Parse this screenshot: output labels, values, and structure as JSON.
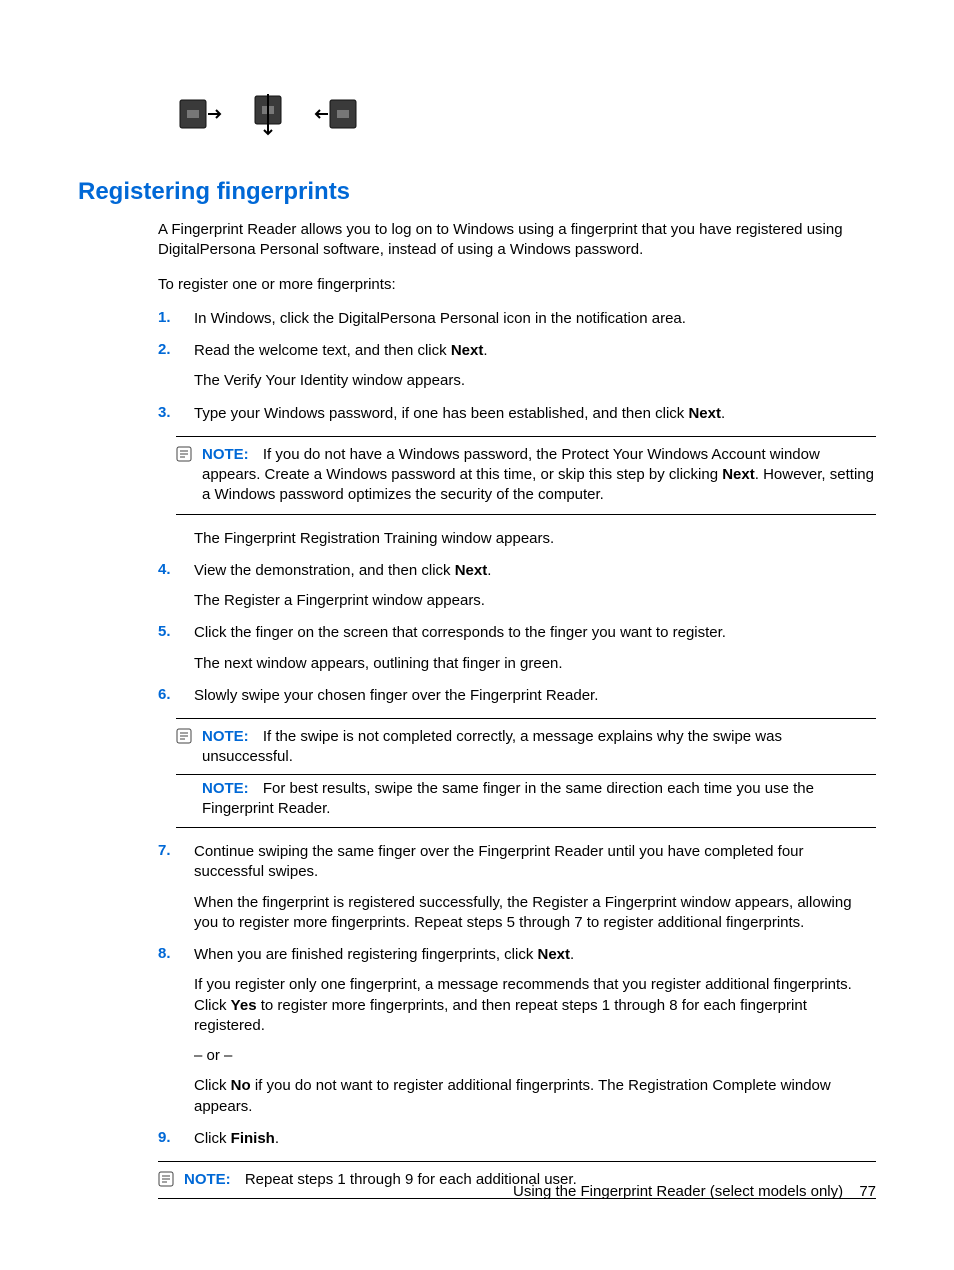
{
  "heading": "Registering fingerprints",
  "intro1": "A Fingerprint Reader allows you to log on to Windows using a fingerprint that you have registered using DigitalPersona Personal software, instead of using a Windows password.",
  "intro2": "To register one or more fingerprints:",
  "steps": {
    "s1": {
      "num": "1.",
      "text": "In Windows, click the DigitalPersona Personal icon in the notification area."
    },
    "s2": {
      "num": "2.",
      "text_a": "Read the welcome text, and then click ",
      "text_bold": "Next",
      "text_b": ".",
      "sub": "The Verify Your Identity window appears."
    },
    "s3": {
      "num": "3.",
      "text_a": "Type your Windows password, if one has been established, and then click ",
      "text_bold": "Next",
      "text_b": "."
    },
    "note1": {
      "label": "NOTE:",
      "text_a": "If you do not have a Windows password, the Protect Your Windows Account window appears. Create a Windows password at this time, or skip this step by clicking ",
      "text_bold": "Next",
      "text_b": ". However, setting a Windows password optimizes the security of the computer."
    },
    "post_note1": "The Fingerprint Registration Training window appears.",
    "s4": {
      "num": "4.",
      "text_a": "View the demonstration, and then click ",
      "text_bold": "Next",
      "text_b": ".",
      "sub": "The Register a Fingerprint window appears."
    },
    "s5": {
      "num": "5.",
      "text": "Click the finger on the screen that corresponds to the finger you want to register.",
      "sub": "The next window appears, outlining that finger in green."
    },
    "s6": {
      "num": "6.",
      "text": "Slowly swipe your chosen finger over the Fingerprint Reader."
    },
    "note2a": {
      "label": "NOTE:",
      "text": "If the swipe is not completed correctly, a message explains why the swipe was unsuccessful."
    },
    "note2b": {
      "label": "NOTE:",
      "text": "For best results, swipe the same finger in the same direction each time you use the Fingerprint Reader."
    },
    "s7": {
      "num": "7.",
      "text": "Continue swiping the same finger over the Fingerprint Reader until you have completed four successful swipes.",
      "sub": "When the fingerprint is registered successfully, the Register a Fingerprint window appears, allowing you to register more fingerprints. Repeat steps 5 through 7 to register additional fingerprints."
    },
    "s8": {
      "num": "8.",
      "text_a": "When you are finished registering fingerprints, click ",
      "text_bold": "Next",
      "text_b": ".",
      "sub1_a": "If you register only one fingerprint, a message recommends that you register additional fingerprints. Click ",
      "sub1_bold": "Yes",
      "sub1_b": " to register more fingerprints, and then repeat steps 1 through 8 for each fingerprint registered.",
      "or": "– or –",
      "sub2_a": "Click ",
      "sub2_bold": "No",
      "sub2_b": " if you do not want to register additional fingerprints. The Registration Complete window appears."
    },
    "s9": {
      "num": "9.",
      "text_a": "Click ",
      "text_bold": "Finish",
      "text_b": "."
    }
  },
  "note3": {
    "label": "NOTE:",
    "text": "Repeat steps 1 through 9 for each additional user."
  },
  "footer": {
    "section": "Using the Fingerprint Reader (select models only)",
    "page": "77"
  }
}
